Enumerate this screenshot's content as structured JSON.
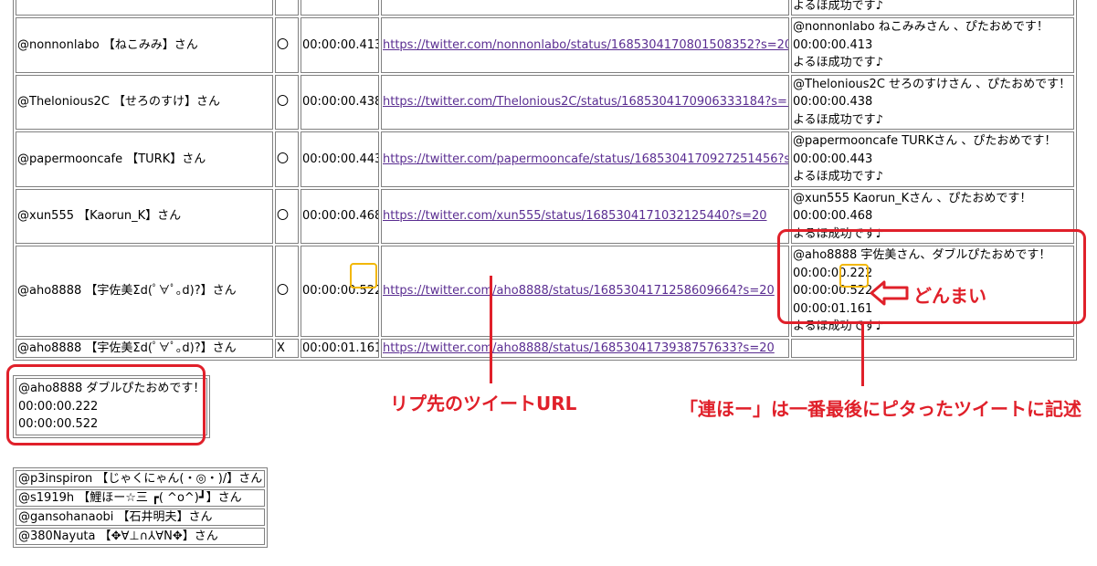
{
  "rows": [
    {
      "name": "@nonnonlabo 【ねこみみ】さん",
      "mark": "〇",
      "time": "00:00:00.413",
      "url": "https://twitter.com/nonnonlabo/status/1685304170801508352?s=20",
      "message": [
        "@nonnonlabo ねこみみさん 、ぴたおめです！",
        "00:00:00.413",
        "よるほ成功です♪"
      ]
    },
    {
      "name": "@Thelonious2C 【せろのすけ】さん",
      "mark": "〇",
      "time": "00:00:00.438",
      "url": "https://twitter.com/Thelonious2C/status/1685304170906333184?s=20",
      "message": [
        "@Thelonious2C せろのすけさん 、ぴたおめです！",
        "00:00:00.438",
        "よるほ成功です♪"
      ]
    },
    {
      "name": "@papermooncafe 【TURK】さん",
      "mark": "〇",
      "time": "00:00:00.443",
      "url": "https://twitter.com/papermooncafe/status/1685304170927251456?s=20",
      "message": [
        "@papermooncafe TURKさん 、ぴたおめです！",
        "00:00:00.443",
        "よるほ成功です♪"
      ]
    },
    {
      "name": "@xun555 【Kaorun_K】さん",
      "mark": "〇",
      "time": "00:00:00.468",
      "url": "https://twitter.com/xun555/status/1685304171032125440?s=20",
      "message": [
        "@xun555 Kaorun_Kさん 、ぴたおめです！",
        "00:00:00.468",
        "よるほ成功です♪"
      ]
    },
    {
      "name": "@aho8888 【宇佐美Σd(ﾟ∀ﾟ｡d)?】さん",
      "mark": "〇",
      "time": "00:00:00.522",
      "url": "https://twitter.com/aho8888/status/1685304171258609664?s=20",
      "message": [
        "@aho8888 宇佐美さん、ダブルぴたおめです！",
        "00:00:00.222",
        "00:00:00.522",
        "00:00:01.161",
        "よるほ成功です♪"
      ]
    },
    {
      "name": "@aho8888 【宇佐美Σd(ﾟ∀ﾟ｡d)?】さん",
      "mark": "X",
      "time": "00:00:01.161",
      "url": "https://twitter.com/aho8888/status/1685304173938757633?s=20",
      "message": []
    }
  ],
  "top_partial_message": "よるほ成功です♪",
  "wip_box": [
    "@aho8888 ダブルぴたおめです！",
    "00:00:00.222",
    "00:00:00.522"
  ],
  "remaining": [
    "@p3inspiron 【じゃくにゃん(・◎・)/】さん",
    "@s1919h 【鯉ほー☆三 ┏( ^o^)┛】さん",
    "@gansohanaobi 【石井明夫】さん",
    "@380Nayuta 【✥∀⊥∩⅄∀N✥】さん"
  ],
  "annotations": {
    "reply_url": "リプ先のツイートURL",
    "renho_note": "「連ほー」は一番最後にピタったツイートに記述",
    "donmai": "どんまい"
  },
  "colors": {
    "callout": "#e0202a",
    "highlight": "#f2b705",
    "link": "#5a2d91"
  }
}
